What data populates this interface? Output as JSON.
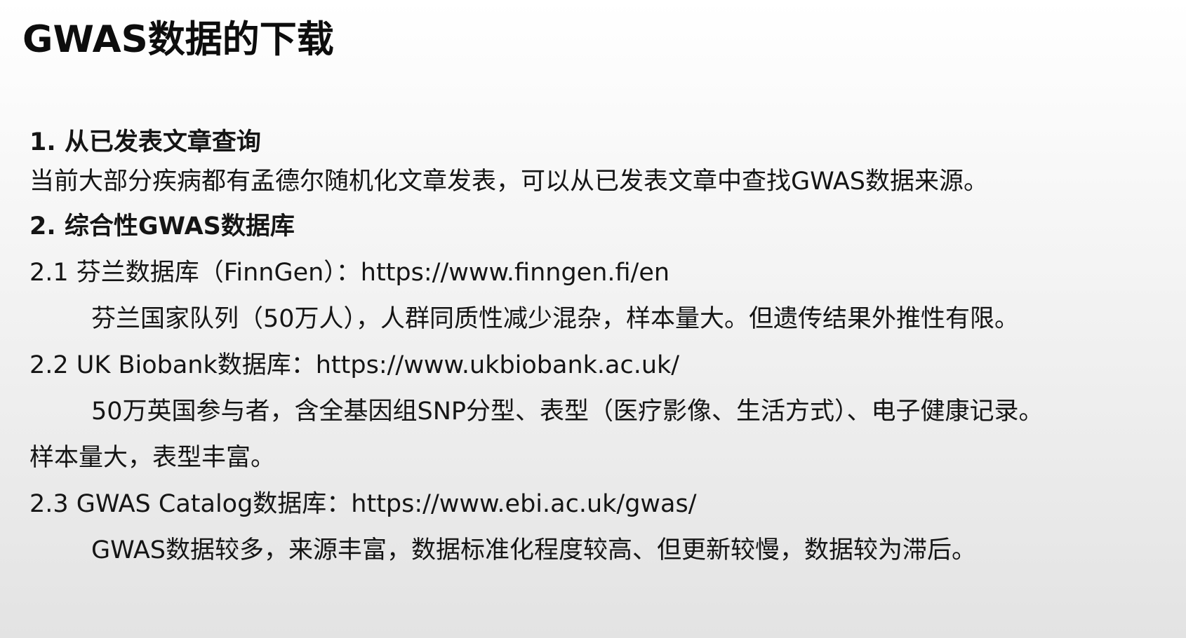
{
  "title": "GWAS数据的下载",
  "sections": [
    {
      "heading": "1. 从已发表文章查询",
      "body": "当前大部分疾病都有孟德尔随机化文章发表，可以从已发表文章中查找GWAS数据来源。"
    },
    {
      "heading": "2. 综合性GWAS数据库",
      "items": [
        {
          "label": "2.1 芬兰数据库（FinnGen）：https://www.finngen.fi/en",
          "description": "芬兰国家队列（50万人），人群同质性减少混杂，样本量大。但遗传结果外推性有限。"
        },
        {
          "label": "2.2 UK Biobank数据库：https://www.ukbiobank.ac.uk/",
          "description": "50万英国参与者，含全基因组SNP分型、表型（医疗影像、生活方式）、电子健康记录。",
          "description_cont": "样本量大，表型丰富。"
        },
        {
          "label": "2.3 GWAS Catalog数据库：https://www.ebi.ac.uk/gwas/",
          "description": "GWAS数据较多，来源丰富，数据标准化程度较高、但更新较慢，数据较为滞后。"
        }
      ]
    }
  ]
}
